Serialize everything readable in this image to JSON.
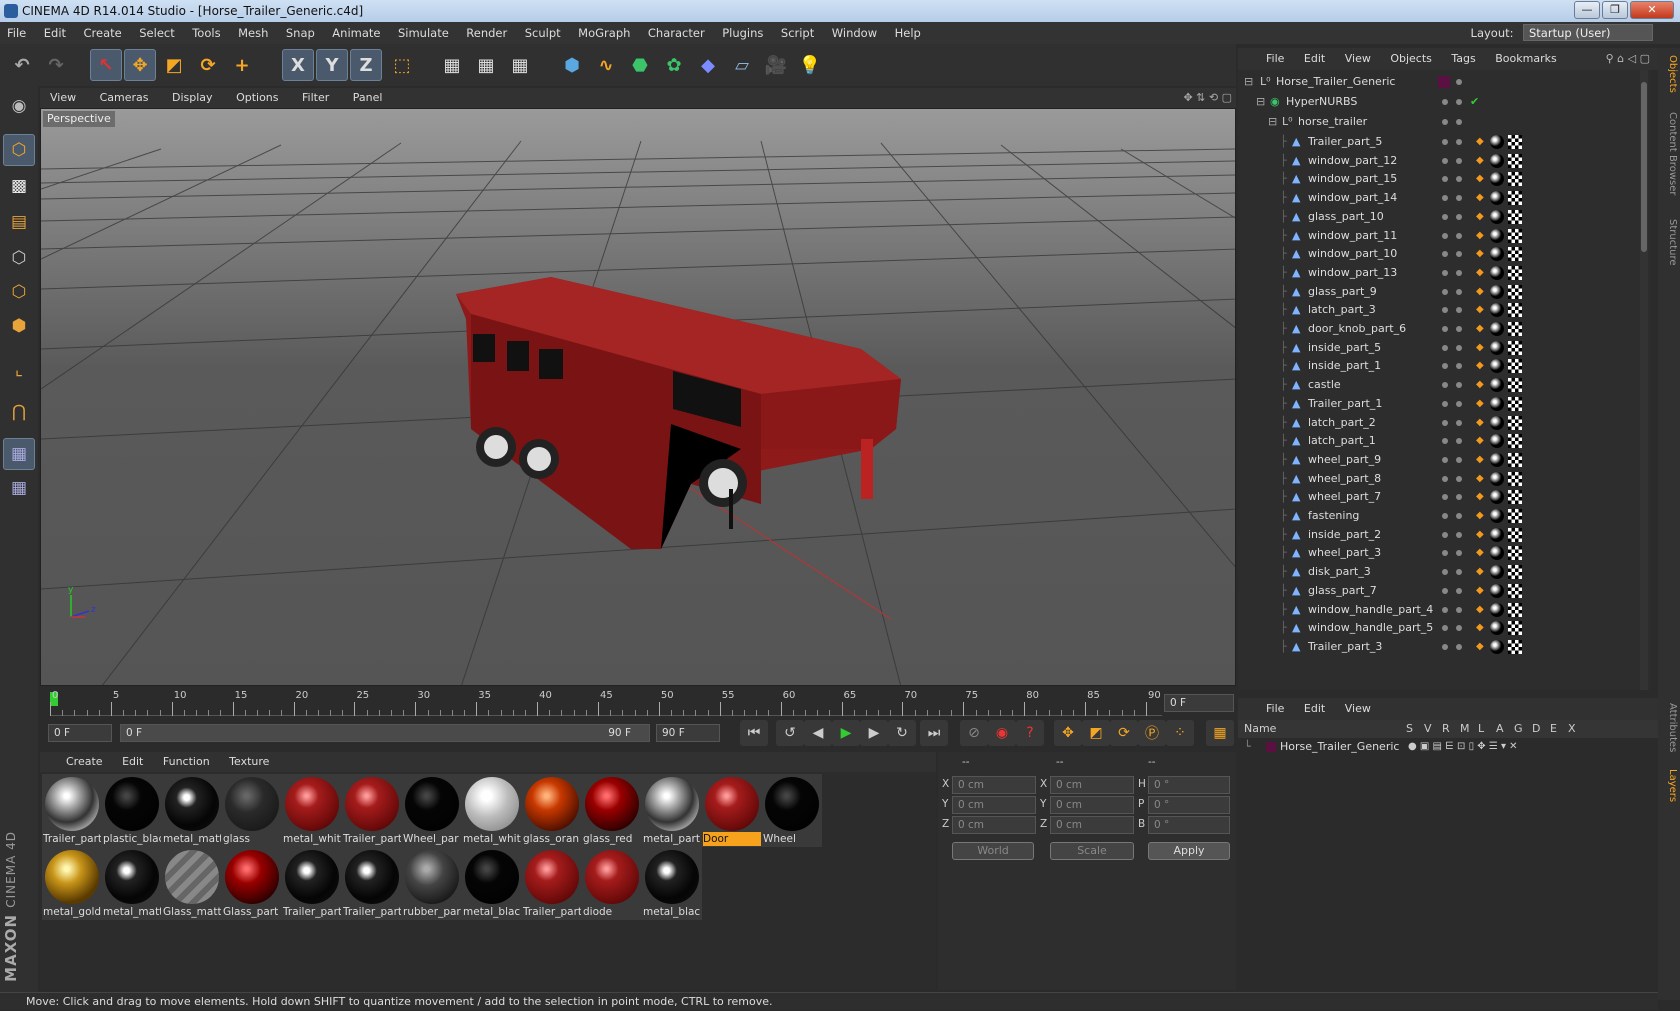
{
  "window": {
    "title": "CINEMA 4D R14.014 Studio - [Horse_Trailer_Generic.c4d]"
  },
  "menubar": {
    "items": [
      "File",
      "Edit",
      "Create",
      "Select",
      "Tools",
      "Mesh",
      "Snap",
      "Animate",
      "Simulate",
      "Render",
      "Sculpt",
      "MoGraph",
      "Character",
      "Plugins",
      "Script",
      "Window",
      "Help"
    ],
    "layout_label": "Layout:",
    "layout_value": "Startup (User)"
  },
  "toolbar": {
    "x_label": "X",
    "y_label": "Y",
    "z_label": "Z"
  },
  "viewport": {
    "menu": [
      "View",
      "Cameras",
      "Display",
      "Options",
      "Filter",
      "Panel"
    ],
    "label": "Perspective",
    "axis_y": "y",
    "axis_z": "z"
  },
  "timeline": {
    "ticks": [
      "0",
      "5",
      "10",
      "15",
      "20",
      "25",
      "30",
      "35",
      "40",
      "45",
      "50",
      "55",
      "60",
      "65",
      "70",
      "75",
      "80",
      "85",
      "90"
    ],
    "current_frame": "0 F",
    "start_field": "0 F",
    "slider_start": "0 F",
    "slider_end": "90 F",
    "end_field": "90 F"
  },
  "materials_menu": [
    "Create",
    "Edit",
    "Function",
    "Texture"
  ],
  "materials": [
    {
      "name": "Trailer_part",
      "color": "#8f8f8f",
      "style": "chrome"
    },
    {
      "name": "plastic_blac",
      "color": "#050505",
      "style": "black"
    },
    {
      "name": "metal_matt",
      "color": "#1a1a1a",
      "style": "darkgloss"
    },
    {
      "name": "glass",
      "color": "#2a2a2a",
      "style": "dark"
    },
    {
      "name": "metal_whit",
      "color": "#8c1515",
      "style": "red"
    },
    {
      "name": "Trailer_part",
      "color": "#8c1515",
      "style": "red"
    },
    {
      "name": "Wheel_par",
      "color": "#050505",
      "style": "black"
    },
    {
      "name": "metal_whit",
      "color": "#d0d0d0",
      "style": "white"
    },
    {
      "name": "glass_oran",
      "color": "#b33000",
      "style": "orange"
    },
    {
      "name": "glass_red",
      "color": "#8a0000",
      "style": "glassred"
    },
    {
      "name": "metal_part",
      "color": "#7a7a7a",
      "style": "chrome"
    },
    {
      "name": "Door",
      "color": "#8c1515",
      "style": "red",
      "selected": true
    },
    {
      "name": "Wheel",
      "color": "#050505",
      "style": "black"
    },
    {
      "name": "metal_gold",
      "color": "#8a6a10",
      "style": "gold"
    },
    {
      "name": "metal_matt",
      "color": "#111",
      "style": "darkgloss"
    },
    {
      "name": "Glass_matt",
      "color": "#777",
      "style": "stripe"
    },
    {
      "name": "Glass_part",
      "color": "#6a1a1a",
      "style": "glassred"
    },
    {
      "name": "Trailer_part",
      "color": "#111",
      "style": "darkgloss"
    },
    {
      "name": "Trailer_part",
      "color": "#111",
      "style": "darkgloss"
    },
    {
      "name": "rubber_par",
      "color": "#333",
      "style": "rubber"
    },
    {
      "name": "metal_blacl",
      "color": "#050505",
      "style": "black"
    },
    {
      "name": "Trailer_part",
      "color": "#9a1818",
      "style": "red"
    },
    {
      "name": "diode",
      "color": "#8a0a0a",
      "style": "red"
    },
    {
      "name": "metal_blacl",
      "color": "#050505",
      "style": "darkgloss"
    }
  ],
  "coords": {
    "head1": "--",
    "head2": "--",
    "head3": "--",
    "x": "0 cm",
    "y": "0 cm",
    "z": "0 cm",
    "sx": "0 cm",
    "sy": "0 cm",
    "sz": "0 cm",
    "h": "0 °",
    "p": "0 °",
    "b": "0 °",
    "labels": {
      "x": "X",
      "y": "Y",
      "z": "Z",
      "sx": "X",
      "sy": "Y",
      "sz": "Z",
      "h": "H",
      "p": "P",
      "b": "B"
    },
    "world": "World",
    "scale": "Scale",
    "apply": "Apply"
  },
  "objects_menu": [
    "File",
    "Edit",
    "View",
    "Objects",
    "Tags",
    "Bookmarks"
  ],
  "objects": {
    "root": "Horse_Trailer_Generic",
    "nurbs": "HyperNURBS",
    "group": "horse_trailer",
    "children": [
      "Trailer_part_5",
      "window_part_12",
      "window_part_15",
      "window_part_14",
      "glass_part_10",
      "window_part_11",
      "window_part_10",
      "window_part_13",
      "glass_part_9",
      "latch_part_3",
      "door_knob_part_6",
      "inside_part_5",
      "inside_part_1",
      "castle",
      "Trailer_part_1",
      "latch_part_2",
      "latch_part_1",
      "wheel_part_9",
      "wheel_part_8",
      "wheel_part_7",
      "fastening",
      "inside_part_2",
      "wheel_part_3",
      "disk_part_3",
      "glass_part_7",
      "window_handle_part_4",
      "window_handle_part_5",
      "Trailer_part_3"
    ]
  },
  "side_tabs": [
    "Objects",
    "Content Browser",
    "Structure",
    "Attributes",
    "Layers"
  ],
  "layers": {
    "menu": [
      "File",
      "Edit",
      "View"
    ],
    "header_name": "Name",
    "columns": [
      "S",
      "V",
      "R",
      "M",
      "L",
      "A",
      "G",
      "D",
      "E",
      "X"
    ],
    "row": "Horse_Trailer_Generic"
  },
  "status": "Move: Click and drag to move elements. Hold down SHIFT to quantize movement / add to the selection in point mode, CTRL to remove."
}
